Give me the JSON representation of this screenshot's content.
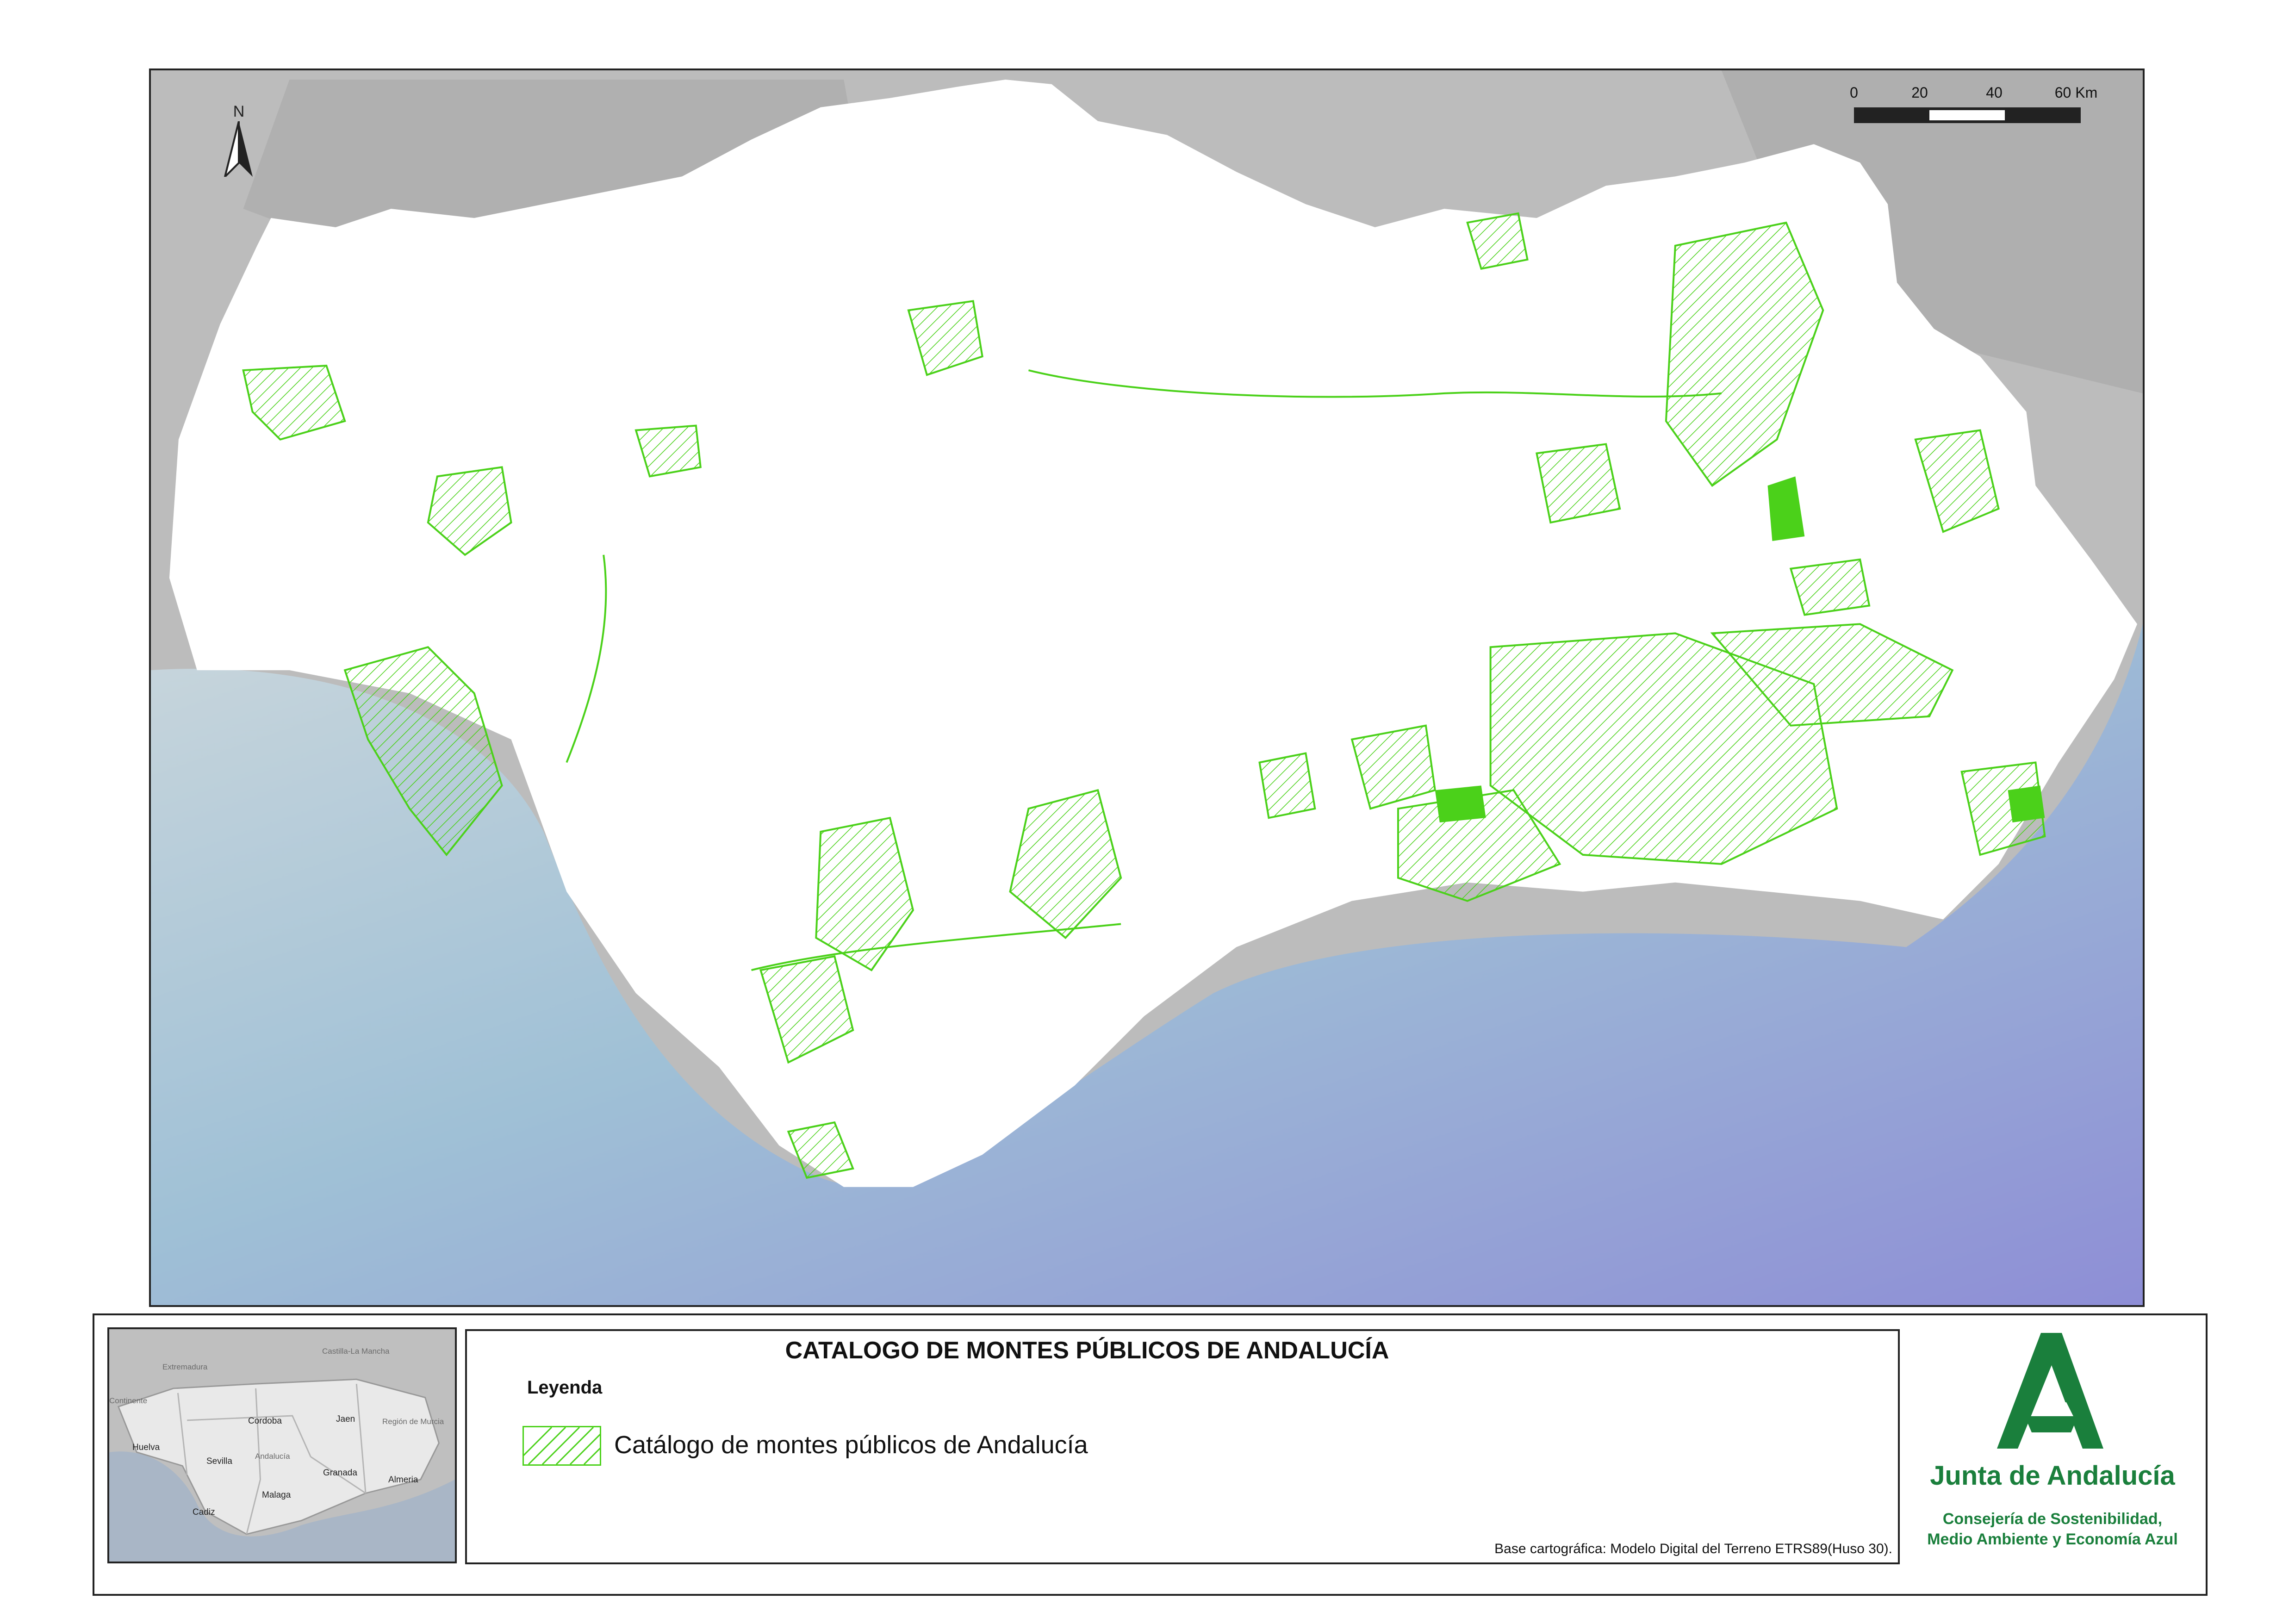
{
  "map": {
    "north_label": "N",
    "scale_ticks": [
      "0",
      "20",
      "40",
      "60 Km"
    ],
    "colors": {
      "land_region": "#ffffff",
      "land_outside": "#bdbdbd",
      "sea_shallow": "#b9d0db",
      "sea_deep": "#8f8fd8",
      "forest_hatch": "#4bd11a"
    }
  },
  "inset": {
    "labels": {
      "extremadura": "Extremadura",
      "castilla": "Castilla-La Mancha",
      "continente": "Continente",
      "cordoba": "Cordoba",
      "jaen": "Jaen",
      "murcia": "Región de Murcia",
      "huelva": "Huelva",
      "sevilla": "Sevilla",
      "andalucia": "Andalucía",
      "granada": "Granada",
      "almeria": "Almeria",
      "malaga": "Malaga",
      "cadiz": "Cadiz"
    }
  },
  "legend": {
    "title": "CATALOGO DE MONTES PÚBLICOS DE ANDALUCÍA",
    "heading": "Leyenda",
    "item_label": "Catálogo de montes públicos de Andalucía",
    "source": "Base cartográfica: Modelo Digital del Terreno ETRS89(Huso 30)."
  },
  "logo": {
    "name": "Junta de Andalucía",
    "dept_line1": "Consejería de Sostenibilidad,",
    "dept_line2": "Medio Ambiente y Economía Azul",
    "color": "#1a7f3c"
  }
}
